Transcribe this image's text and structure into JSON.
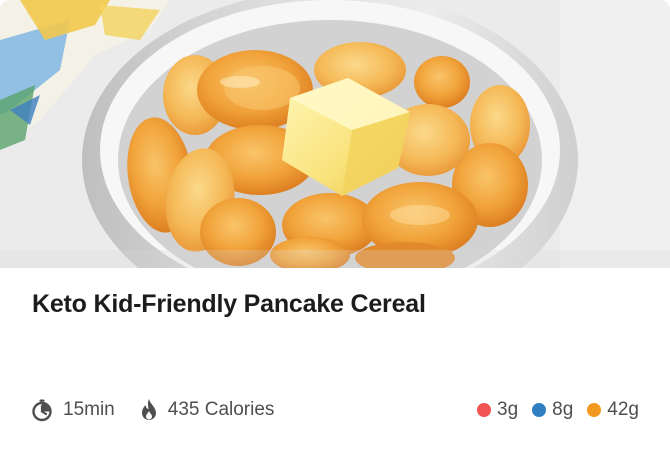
{
  "recipe": {
    "title": "Keto Kid-Friendly Pancake Cereal",
    "time": "15min",
    "calories": "435 Calories"
  },
  "macros": [
    {
      "value": "3g",
      "color": "#f05454"
    },
    {
      "value": "8g",
      "color": "#2f7fc1"
    },
    {
      "value": "42g",
      "color": "#f39a1e"
    }
  ],
  "icons": {
    "time": "stopwatch-icon",
    "calories": "flame-icon"
  },
  "photo": {
    "subject": "pancake-cereal-bowl-with-butter"
  }
}
